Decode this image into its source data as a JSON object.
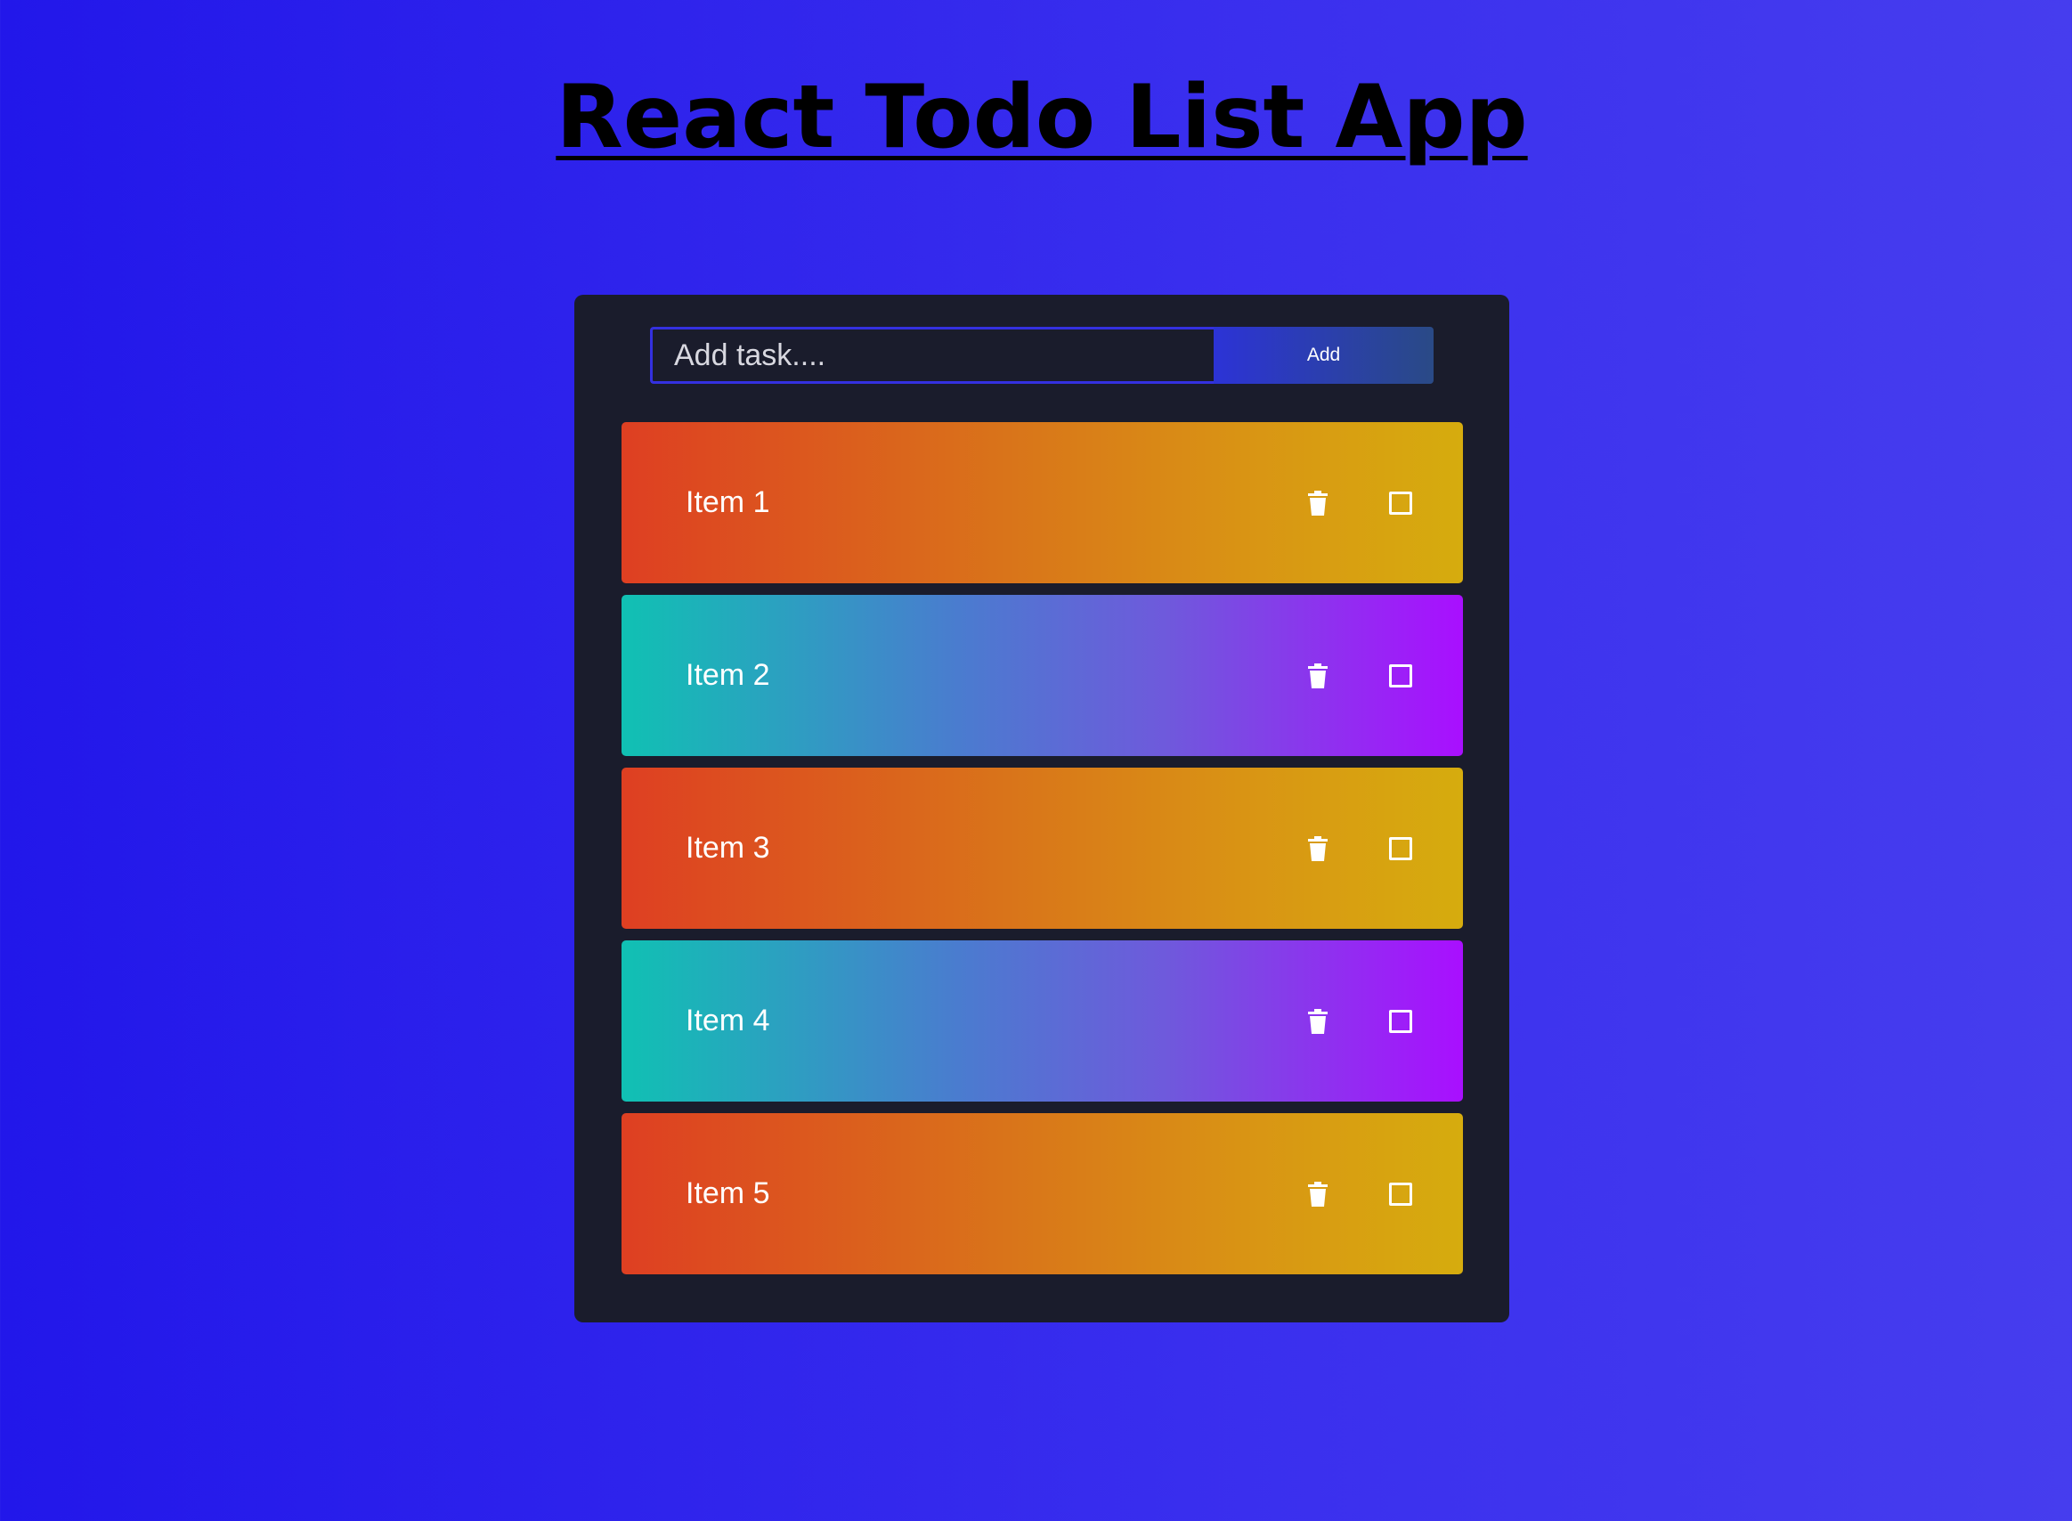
{
  "header": {
    "title": "React Todo List App"
  },
  "form": {
    "placeholder": "Add task....",
    "value": "",
    "add_label": "Add"
  },
  "items": [
    {
      "label": "Item 1",
      "theme": "warm",
      "completed": false
    },
    {
      "label": "Item 2",
      "theme": "cool",
      "completed": false
    },
    {
      "label": "Item 3",
      "theme": "warm",
      "completed": false
    },
    {
      "label": "Item 4",
      "theme": "cool",
      "completed": false
    },
    {
      "label": "Item 5",
      "theme": "warm",
      "completed": false
    }
  ],
  "icons": {
    "delete": "trash-icon",
    "complete": "checkbox-icon"
  },
  "colors": {
    "background": "#2a22ec",
    "card": "#1a1c2c",
    "title": "#000000",
    "input_border": "#3430e0",
    "warm_start": "#de3f22",
    "warm_end": "#d6ac0e",
    "cool_start": "#10c1b3",
    "cool_end": "#a90fff"
  }
}
